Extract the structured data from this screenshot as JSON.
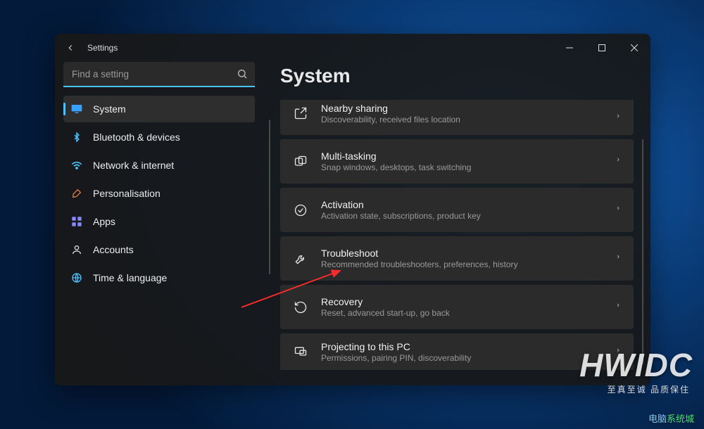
{
  "app_title": "Settings",
  "search": {
    "placeholder": "Find a setting"
  },
  "sidebar": {
    "items": [
      {
        "label": "System",
        "active": true,
        "icon": "display"
      },
      {
        "label": "Bluetooth & devices",
        "active": false,
        "icon": "bluetooth"
      },
      {
        "label": "Network & internet",
        "active": false,
        "icon": "wifi"
      },
      {
        "label": "Personalisation",
        "active": false,
        "icon": "brush"
      },
      {
        "label": "Apps",
        "active": false,
        "icon": "apps"
      },
      {
        "label": "Accounts",
        "active": false,
        "icon": "account"
      },
      {
        "label": "Time & language",
        "active": false,
        "icon": "globe"
      }
    ]
  },
  "page_title": "System",
  "cards": [
    {
      "title": "Nearby sharing",
      "subtitle": "Discoverability, received files location",
      "icon": "share",
      "cut": "top"
    },
    {
      "title": "Multi-tasking",
      "subtitle": "Snap windows, desktops, task switching",
      "icon": "multitask",
      "cut": ""
    },
    {
      "title": "Activation",
      "subtitle": "Activation state, subscriptions, product key",
      "icon": "activation",
      "cut": ""
    },
    {
      "title": "Troubleshoot",
      "subtitle": "Recommended troubleshooters, preferences, history",
      "icon": "troubleshoot",
      "cut": ""
    },
    {
      "title": "Recovery",
      "subtitle": "Reset, advanced start-up, go back",
      "icon": "recovery",
      "cut": ""
    },
    {
      "title": "Projecting to this PC",
      "subtitle": "Permissions, pairing PIN, discoverability",
      "icon": "project",
      "cut": "bot"
    }
  ],
  "watermark": {
    "big": "HWIDC",
    "sub": "至真至诚 品质保住",
    "logo_a": "电脑",
    "logo_b": "系统城"
  }
}
